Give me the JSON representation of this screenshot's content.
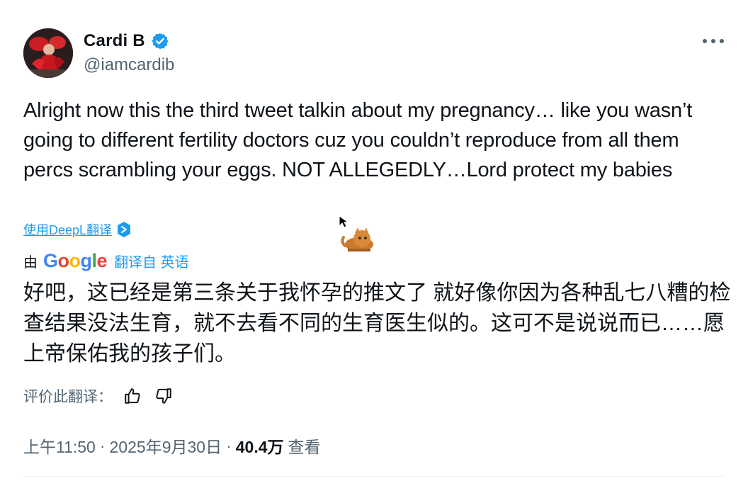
{
  "author": {
    "display_name": "Cardi B",
    "handle": "@iamcardib",
    "verified_icon": "verified-badge-icon"
  },
  "tweet": {
    "text": "Alright now this the third tweet talkin about my pregnancy… like you wasn’t going to different fertility doctors cuz you couldn’t reproduce from all them percs scrambling your eggs. NOT ALLEGEDLY…Lord protect my babies"
  },
  "translate": {
    "deepl_label": "使用DeepL翻译",
    "by_prefix": "由",
    "google": [
      "G",
      "o",
      "o",
      "g",
      "l",
      "e"
    ],
    "translated_from": "翻译自 英语",
    "translated_text": "好吧，这已经是第三条关于我怀孕的推文了 就好像你因为各种乱七八糟的检查结果没法生育，就不去看不同的生育医生似的。这可不是说说而已……愿上帝保佑我的孩子们。",
    "rate_label": "评价此翻译："
  },
  "meta": {
    "time": "上午11:50",
    "date": "2025年9月30日",
    "separator": "·",
    "views_count": "40.4万",
    "views_label": "查看"
  },
  "colors": {
    "text": "#0f1419",
    "secondary": "#536471",
    "link": "#1d9bf0",
    "verified": "#1d9bf0"
  }
}
